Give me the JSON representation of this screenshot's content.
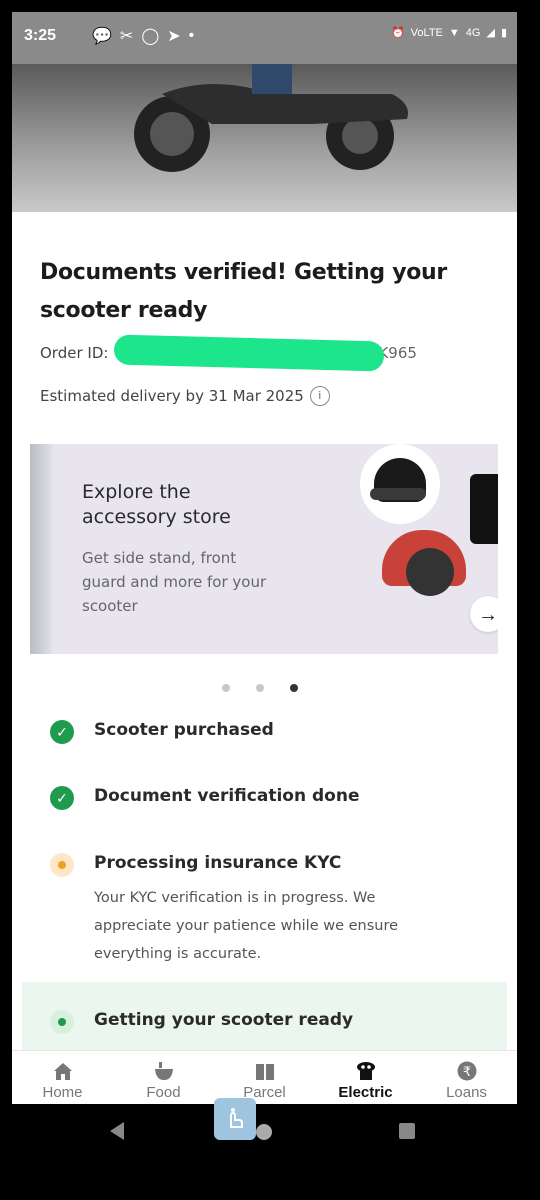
{
  "statusbar": {
    "time": "3:25",
    "network": "4G",
    "volte": "VoLTE"
  },
  "order": {
    "title": "Documents verified! Getting your scooter ready",
    "order_id_label": "Order ID:",
    "order_id_visible_suffix": "NK965",
    "delivery_text": "Estimated delivery by 31 Mar 2025",
    "info_icon": "i"
  },
  "banner": {
    "title": "Explore the accessory store",
    "subtitle": "Get side stand, front guard and more for your scooter",
    "arrow": "→",
    "active_slide": 3,
    "slide_count": 3
  },
  "steps": [
    {
      "label": "Scooter purchased",
      "status": "done"
    },
    {
      "label": "Document verification done",
      "status": "done"
    },
    {
      "label": "Processing insurance KYC",
      "status": "in-progress",
      "description": "Your KYC verification is in progress. We appreciate your patience while we ensure everything is accurate."
    },
    {
      "label": "Getting your scooter ready",
      "status": "current"
    }
  ],
  "bottom_nav": [
    {
      "label": "Home",
      "icon": "home-icon"
    },
    {
      "label": "Food",
      "icon": "food-icon"
    },
    {
      "label": "Parcel",
      "icon": "parcel-icon"
    },
    {
      "label": "Electric",
      "icon": "electric-icon",
      "active": true
    },
    {
      "label": "Loans",
      "icon": "rupee-icon"
    }
  ],
  "colors": {
    "success": "#1e9b4c",
    "pending": "#f0a020",
    "banner_bg": "#e9e5ee"
  }
}
